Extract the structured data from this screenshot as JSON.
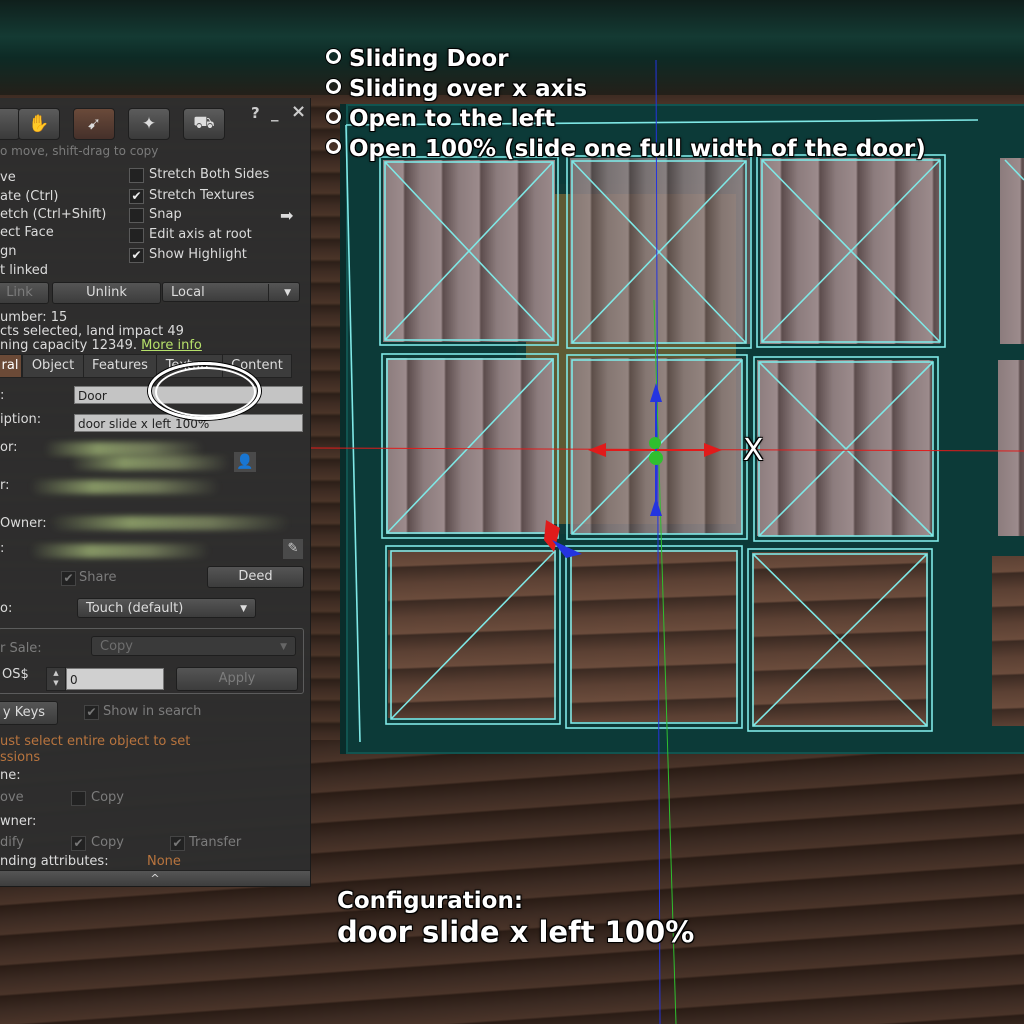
{
  "annotations": {
    "bullets": [
      "Sliding Door",
      "Sliding over x axis",
      "Open to the left",
      "Open 100% (slide one full width of the door)"
    ],
    "config_title": "Configuration:",
    "config_value": "door slide x left 100%",
    "axis_label": "X"
  },
  "panel": {
    "header": {
      "help_icon": "?",
      "minimize_icon": "_",
      "close_icon": "×"
    },
    "hint": "o move, shift-drag to copy",
    "modes": [
      "ve",
      "ate (Ctrl)",
      "etch (Ctrl+Shift)",
      "ect Face",
      "gn",
      "t linked"
    ],
    "options": [
      {
        "label": "Stretch Both Sides",
        "checked": false
      },
      {
        "label": "Stretch Textures",
        "checked": true
      },
      {
        "label": "Snap",
        "checked": false
      },
      {
        "label": "Edit axis at root",
        "checked": false
      },
      {
        "label": "Show Highlight",
        "checked": true
      }
    ],
    "link_label": "Link",
    "unlink_label": "Unlink",
    "ruler_mode": "Local",
    "info": {
      "number": "umber: 15",
      "selected": "cts selected, land impact 49",
      "capacity": "ning capacity 12349.",
      "more_info": "More info"
    },
    "tabs": [
      "ral",
      "Object",
      "Features",
      "Texture",
      "Content"
    ],
    "general": {
      "name_label": ":",
      "name_value": "Door",
      "description_label": "iption:",
      "description_value": "door slide x left 100%",
      "creator_label": "or:",
      "owner_label": "r:",
      "last_owner_label": "Owner:",
      "group_label": ":",
      "share_label": "Share",
      "deed_label": "Deed",
      "click_label": "o:",
      "click_value": "Touch  (default)",
      "for_sale_label": "r Sale:",
      "for_sale_value": "Copy",
      "price_label": "OS$",
      "price_value": "0",
      "apply_label": "Apply",
      "copy_keys_label": "y Keys",
      "show_in_search_label": "Show in search",
      "permissions_warning_1": "ust select entire object to set",
      "permissions_warning_2": "ssions",
      "everyone_label": "ne:",
      "everyone_move": "ove",
      "everyone_copy": "Copy",
      "next_owner_label": "wner:",
      "next_modify": "dify",
      "next_copy": "Copy",
      "next_transfer": "Transfer",
      "pathfinding_label": "nding attributes:",
      "pathfinding_value": "None"
    },
    "collapse_icon": "^"
  },
  "colors": {
    "highlight_outline": "#7fe8e6",
    "x_axis": "#e01b1b",
    "y_axis": "#2fbf2f",
    "z_axis": "#2434e0",
    "panel_active_tab": "#6b4a37",
    "more_info_link": "#b6e06a",
    "warning_text": "#b8743e"
  }
}
